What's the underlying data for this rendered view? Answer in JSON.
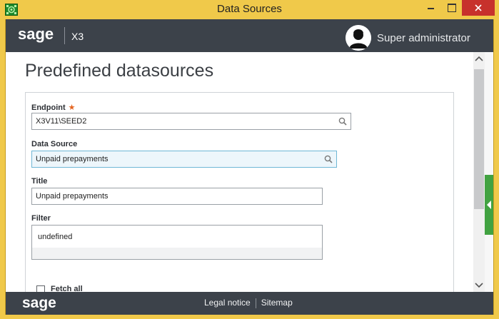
{
  "window": {
    "title": "Data Sources"
  },
  "header": {
    "logo_text": "sage",
    "product": "X3",
    "user_name": "Super administrator"
  },
  "page": {
    "title": "Predefined datasources"
  },
  "form": {
    "endpoint": {
      "label": "Endpoint",
      "required_mark": "★",
      "value": "X3V11\\SEED2"
    },
    "data_source": {
      "label": "Data Source",
      "value": "Unpaid prepayments"
    },
    "title": {
      "label": "Title",
      "value": "Unpaid prepayments"
    },
    "filter": {
      "label": "Filter",
      "value": "undefined"
    },
    "fetch_all": {
      "label": "Fetch all",
      "checked": false
    }
  },
  "footer": {
    "logo_text": "sage",
    "legal_notice": "Legal notice",
    "sitemap": "Sitemap"
  },
  "colors": {
    "titlebar": "#f0c94a",
    "header": "#3c424a",
    "accent_green": "#41a241",
    "required_star": "#e4631f",
    "close_button": "#c7312c"
  },
  "icons": {
    "search": "magnifier",
    "avatar": "user-silhouette",
    "app": "green-app-icon"
  }
}
